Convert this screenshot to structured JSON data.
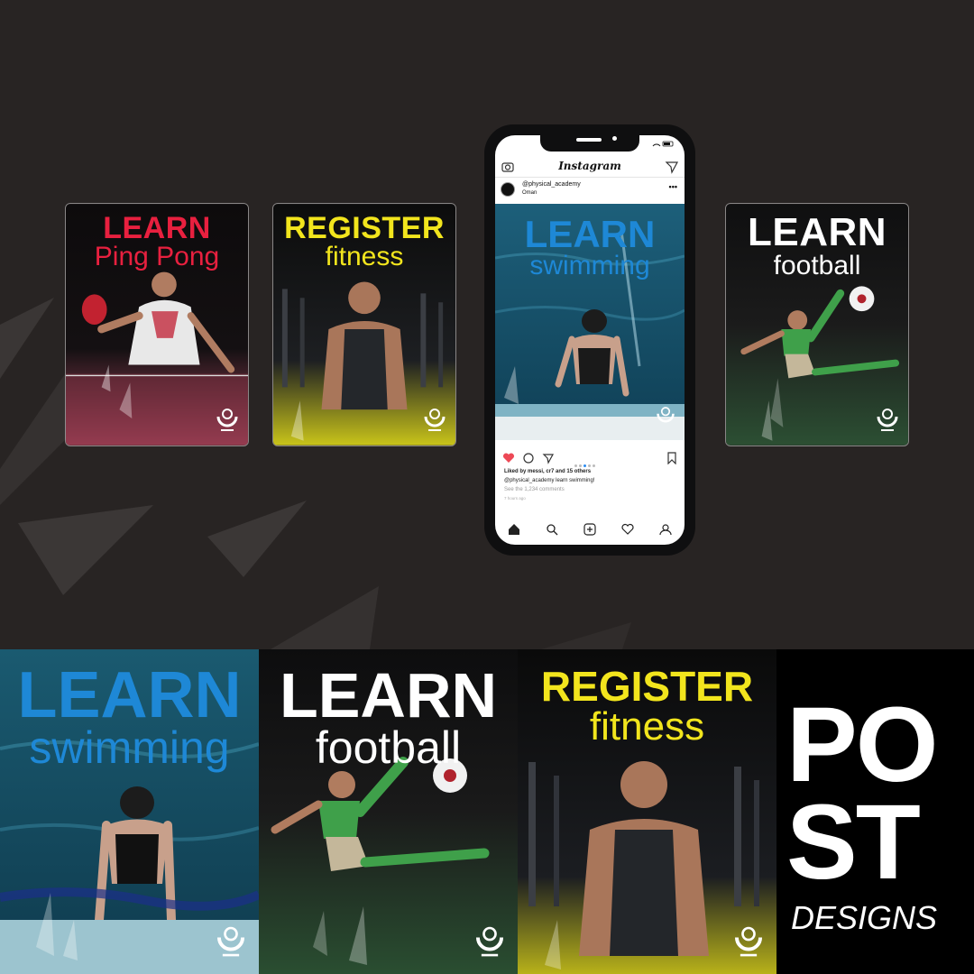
{
  "posts": {
    "pingpong": {
      "line1": "LEARN",
      "line2": "Ping Pong"
    },
    "fitness": {
      "line1": "REGISTER",
      "line2": "fitness"
    },
    "swimming": {
      "line1": "LEARN",
      "line2": "swimming"
    },
    "football": {
      "line1": "LEARN",
      "line2": "football"
    }
  },
  "instagram": {
    "app_name": "Instagram",
    "username": "@physical_academy",
    "location": "Oman",
    "likes_text": "Liked by messi, cr7 and 15 others",
    "caption": "@physical_academy learn swimming!",
    "comments_link": "See the 1,234 comments",
    "time_ago": "7 hours ago",
    "more_symbol": "•••"
  },
  "headline": {
    "title": "POST",
    "title_line2": "ST",
    "title_line1": "PO",
    "subtitle": "DESIGNS"
  },
  "colors": {
    "background": "#282423",
    "pingpong_accent": "#e8203f",
    "fitness_accent": "#f2e51d",
    "swimming_accent": "#1e88d6",
    "football_accent": "#ffffff",
    "ig_heart": "#ed4956"
  },
  "icons": [
    "camera-icon",
    "send-icon",
    "heart-icon",
    "comment-icon",
    "share-icon",
    "bookmark-icon",
    "home-icon",
    "search-icon",
    "add-icon",
    "activity-icon",
    "profile-icon",
    "academy-logo"
  ]
}
